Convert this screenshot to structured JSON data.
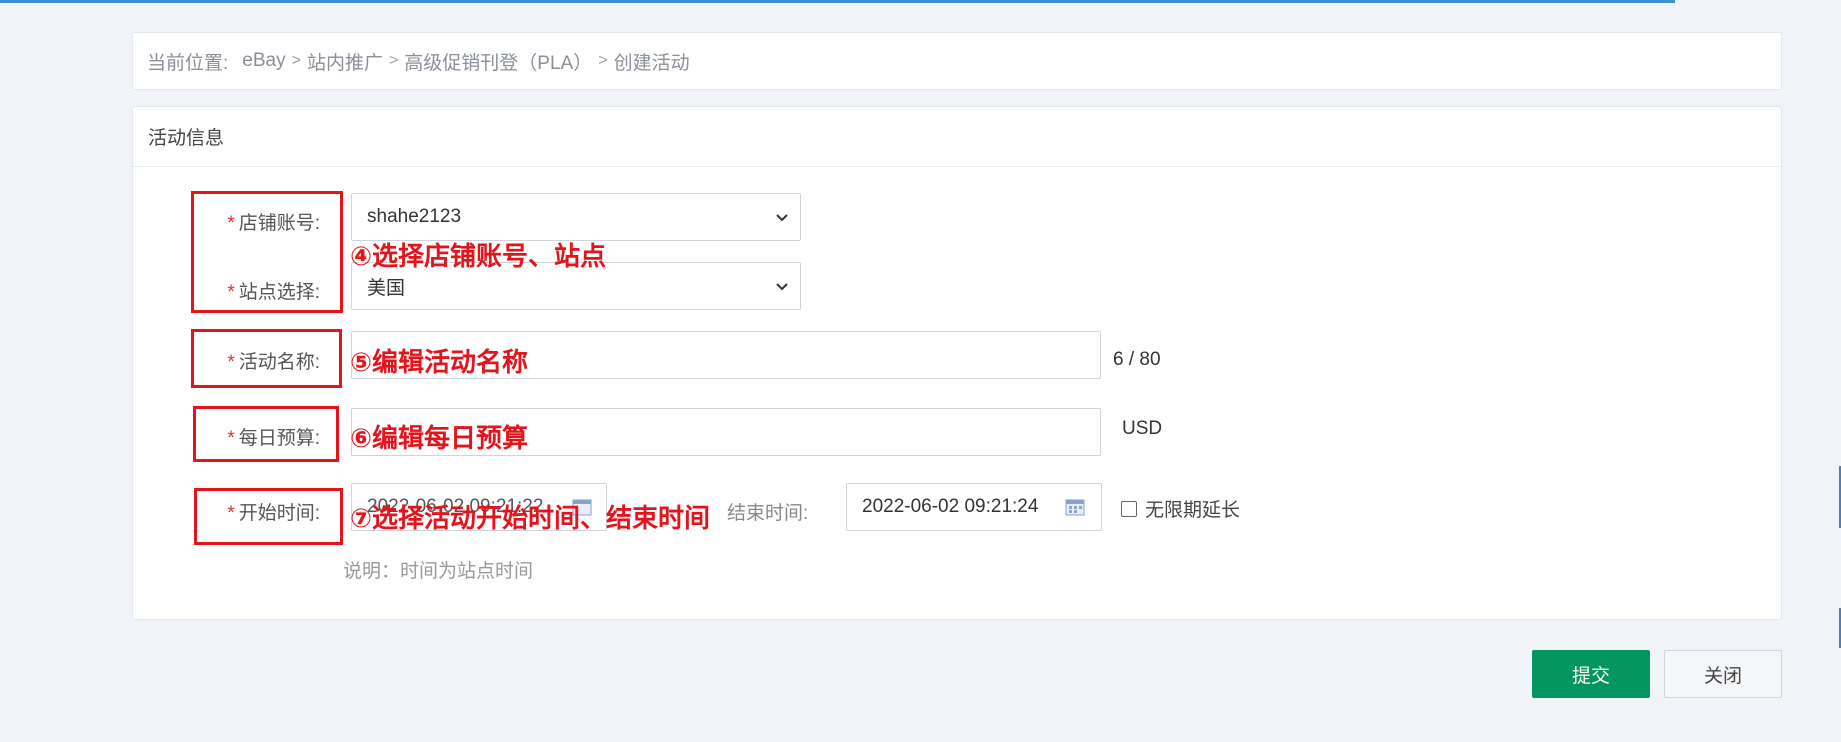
{
  "breadcrumb": {
    "prefix": "当前位置:",
    "items": [
      "eBay",
      "站内推广",
      "高级促销刊登（PLA）",
      "创建活动"
    ]
  },
  "panel": {
    "title": "活动信息"
  },
  "form": {
    "shop_label": "店铺账号:",
    "shop_value": "shahe2123",
    "site_label": "站点选择:",
    "site_value": "美国",
    "name_label": "活动名称:",
    "name_count": "6 / 80",
    "budget_label": "每日预算:",
    "budget_unit": "USD",
    "start_label": "开始时间:",
    "start_value": "2022-06-02 09:21:22",
    "end_label": "结束时间:",
    "end_value": "2022-06-02 09:21:24",
    "unlimited_label": "无限期延长",
    "note": "说明：时间为站点时间",
    "required_mark": "*"
  },
  "annotations": {
    "a4": "④选择店铺账号、站点",
    "a5": "⑤编辑活动名称",
    "a6": "⑥编辑每日预算",
    "a7": "⑦选择活动开始时间、结束时间"
  },
  "buttons": {
    "submit": "提交",
    "close": "关闭"
  },
  "progress": {
    "fill_percent": 91
  },
  "colors": {
    "accent": "#04965f",
    "annotation": "#e3141c",
    "required": "#e03030"
  }
}
